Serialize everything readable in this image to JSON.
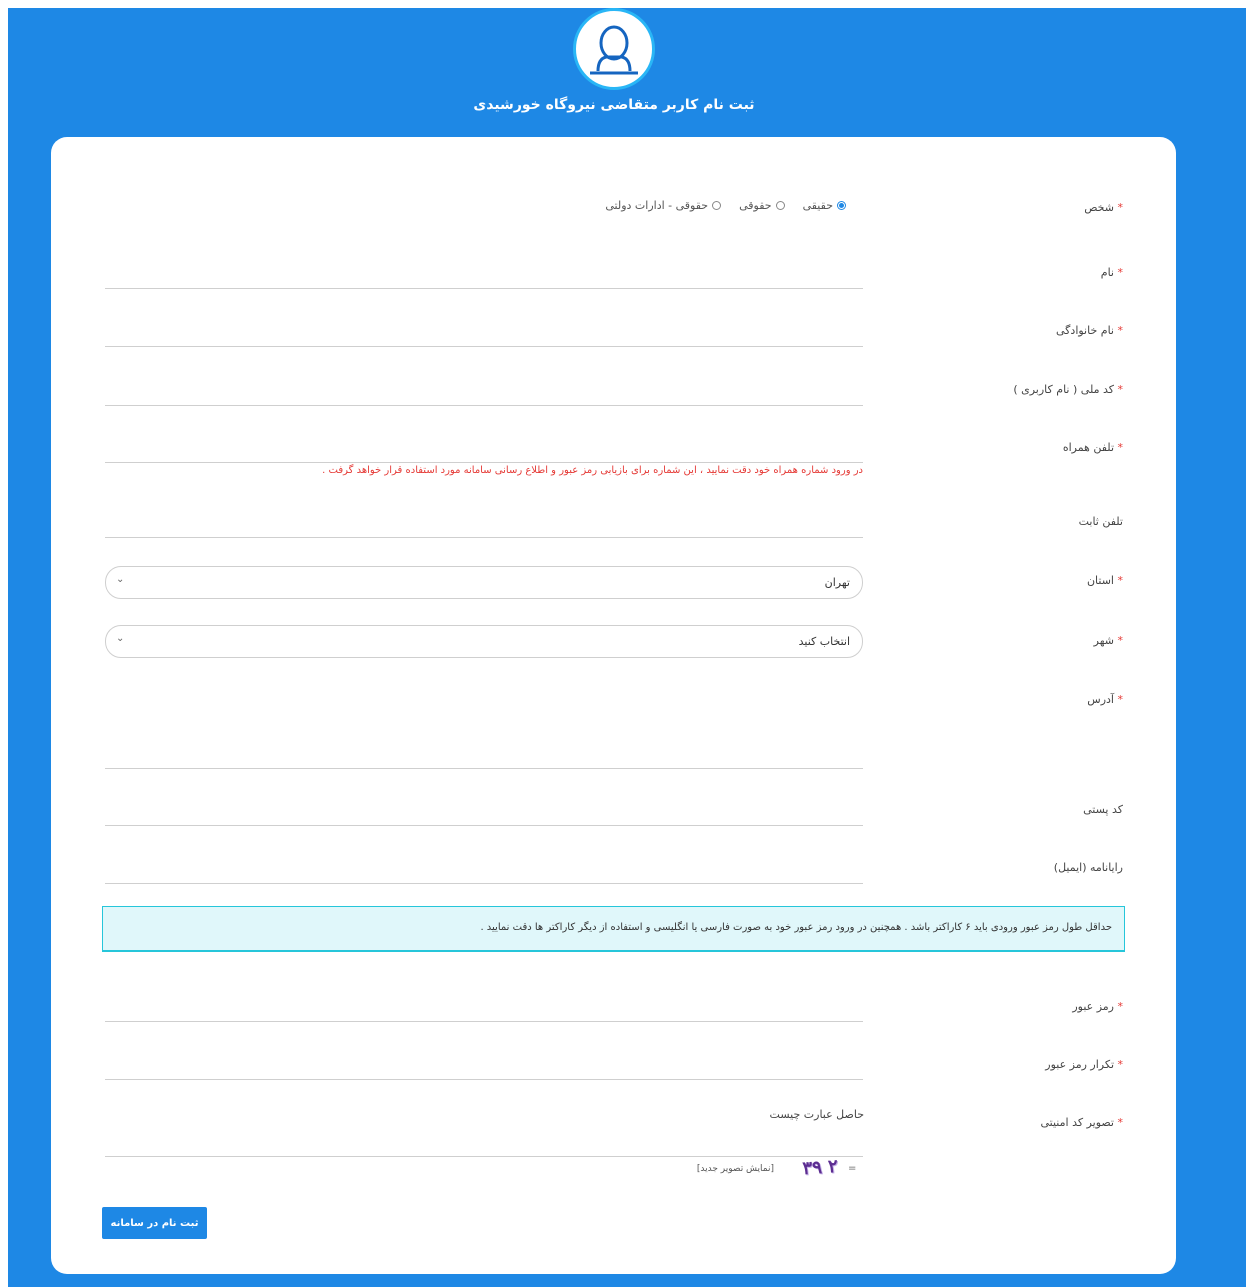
{
  "header": {
    "title": "ثبت نام کاربر متقاضی نیروگاه خورشیدی",
    "icon": "user-icon"
  },
  "form": {
    "required_mark": "*",
    "person": {
      "label": "شخص",
      "options": [
        "حقیقی",
        "حقوقی",
        "حقوقی - ادارات دولتی"
      ],
      "selected": "حقیقی"
    },
    "first_name": {
      "label": "نام",
      "value": ""
    },
    "last_name": {
      "label": "نام خانوادگی",
      "value": ""
    },
    "national_code": {
      "label": "کد ملی ( نام کاربری )",
      "value": ""
    },
    "mobile": {
      "label": "تلفن همراه",
      "value": "",
      "warning": "در ورود شماره همراه خود دقت نمایید ، این شماره برای بازیابی رمز عبور و اطلاع رسانی سامانه مورد استفاده قرار خواهد گرفت ."
    },
    "phone": {
      "label": "تلفن ثابت",
      "value": ""
    },
    "province": {
      "label": "استان",
      "value": "تهران"
    },
    "city": {
      "label": "شهر",
      "value": "انتخاب کنید"
    },
    "address": {
      "label": "آدرس",
      "value": ""
    },
    "postal_code": {
      "label": "کد پستی",
      "value": ""
    },
    "email": {
      "label": "رایانامه (ایمیل)",
      "value": ""
    },
    "password_info": "حداقل طول رمز عبور ورودی باید ۶ کاراکتر باشد . همچنین در ورود رمز عبور خود به صورت فارسی یا انگلیسی و استفاده از دیگر کاراکتر ها دقت نمایید .",
    "password": {
      "label": "رمز عبور",
      "value": ""
    },
    "password_repeat": {
      "label": "تکرار رمز عبور",
      "value": ""
    },
    "captcha": {
      "label": "تصویر کد امنیتی",
      "question": "حاصل عبارت چیست",
      "value": "",
      "equals": "=",
      "image_text": "۲ ۳۹",
      "refresh_link": "[نمایش تصویر جدید]"
    },
    "submit_label": "ثبت نام در سامانه"
  },
  "colors": {
    "primary": "#1e88e5",
    "required": "#e53935",
    "info_bg": "#e0f7fa",
    "info_border": "#26c6da"
  }
}
